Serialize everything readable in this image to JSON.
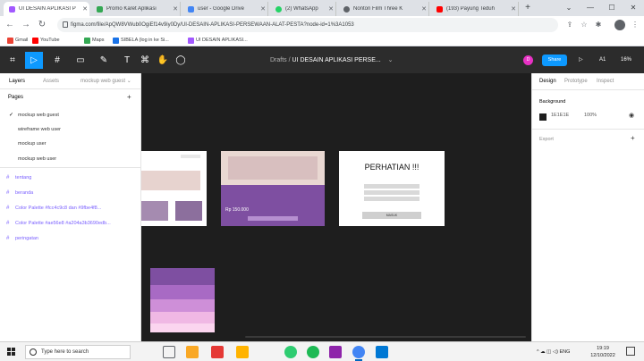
{
  "browser": {
    "tabs": [
      {
        "title": "UI DESAIN APLIKASI P",
        "color": "#a259ff",
        "active": true
      },
      {
        "title": "Promo Karet Aplikasi",
        "color": "#34a853"
      },
      {
        "title": "user - Google Drive",
        "color": "#4285f4"
      },
      {
        "title": "(2) WhatsApp",
        "color": "#25d366"
      },
      {
        "title": "Nonton Film Three K",
        "color": "#5f6368"
      },
      {
        "title": "(193) Payung Teduh",
        "color": "#ff0000"
      }
    ],
    "new_tab": "+",
    "window_controls": [
      "⌄",
      "—",
      "☐",
      "✕"
    ],
    "url": "figma.com/file/ApQW8VWub0OgiEf14v9iy0Dy/UI-DESAIN-APLIKASI-PERSEWAAN-ALAT-PESTA?node-id=1%3A1053",
    "bookmarks": [
      {
        "label": "Gmail",
        "color": "#ea4335"
      },
      {
        "label": "YouTube",
        "color": "#ff0000"
      },
      {
        "label": "Maps",
        "color": "#34a853"
      },
      {
        "label": "SIBELA (log in ke Si...",
        "color": "#1a73e8"
      },
      {
        "label": "UI DESAIN APLIKASI...",
        "color": "#a259ff"
      }
    ]
  },
  "figma": {
    "toolbar": {
      "tools": [
        "⌗",
        "▷",
        "#",
        "▭",
        "✎",
        "T",
        "⌘",
        "◯"
      ],
      "breadcrumb_folder": "Drafts",
      "breadcrumb_sep": " / ",
      "file_name": "UI DESAIN APLIKASI PERSE...",
      "breadcrumb_chevron": "⌄",
      "user_initial": "D",
      "share_label": "Share",
      "play": "▷",
      "multiplayer": "A1",
      "zoom": "16%"
    },
    "left_panel": {
      "tabs": [
        "Layers",
        "Assets"
      ],
      "current_page": "mockup web guest ⌄",
      "pages_label": "Pages",
      "pages_add": "+",
      "pages": [
        {
          "name": "mockup web guest",
          "checked": true
        },
        {
          "name": "wireframe web user"
        },
        {
          "name": "mockup user"
        },
        {
          "name": "mockup web user"
        }
      ],
      "layers": [
        "tentang",
        "beranda",
        "Color Palette #fcc4c9c8 dan #9fbe4f8...",
        "Color Palette #ae56e8 #a204a3b3690edb...",
        "peringatan"
      ]
    },
    "canvas": {
      "dialog_title": "PERHATIAN !!!",
      "dialog_button": "MASUK",
      "rental_price": "Rp 150.000",
      "palette": [
        "#7e4fa1",
        "#a86ac4",
        "#ce8fd8",
        "#f0b8e4",
        "#fbd5ef"
      ],
      "help": "?"
    },
    "right_panel": {
      "tabs": [
        "Design",
        "Prototype",
        "Inspect"
      ],
      "background_label": "Background",
      "bg_hex": "1E1E1E",
      "bg_opacity": "100%",
      "export_label": "Export",
      "export_add": "+"
    }
  },
  "taskbar": {
    "search_placeholder": "Type here to search",
    "apps": [
      "#5f6368",
      "#f9a825",
      "#e53935",
      "#ffb300",
      "#1db954",
      "#2ecc71",
      "#4285f4",
      "#0078d4"
    ],
    "tray_icons": "^  ☁  ◫  ◁)  ENG",
    "time": "19:19",
    "date": "12/10/2022"
  }
}
